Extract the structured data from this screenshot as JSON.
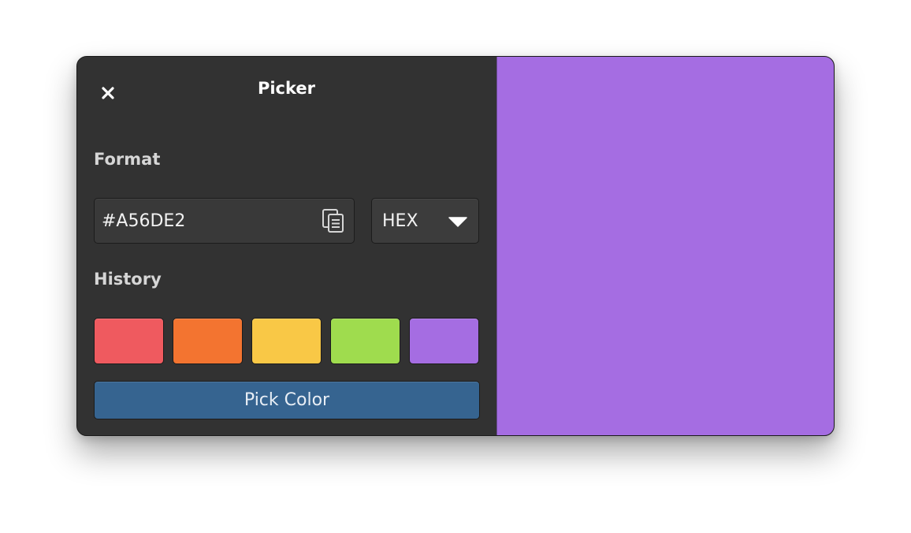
{
  "window": {
    "title": "Picker"
  },
  "format": {
    "label": "Format",
    "hex_value": "#A56DE2",
    "selected_format": "HEX"
  },
  "history": {
    "label": "History",
    "swatches": [
      "#ef5a5f",
      "#f37430",
      "#f9c846",
      "#9fdc4e",
      "#a56de2"
    ]
  },
  "actions": {
    "pick_label": "Pick Color"
  },
  "preview": {
    "color": "#a56de2"
  },
  "icons": {
    "close": "close-icon",
    "copy": "copy-icon",
    "dropdown": "chevron-down-icon"
  }
}
